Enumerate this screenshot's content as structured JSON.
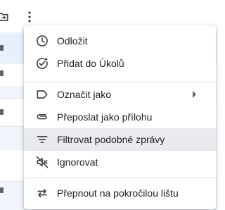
{
  "menu": {
    "items": [
      {
        "label": "Odložit",
        "icon": "clock-icon"
      },
      {
        "label": "Přidat do Úkolů",
        "icon": "add-task-icon"
      },
      {
        "label": "Označit jako",
        "icon": "label-icon",
        "has_submenu": true
      },
      {
        "label": "Přeposlat jako přílohu",
        "icon": "attachment-icon"
      },
      {
        "label": "Filtrovat podobné zprávy",
        "icon": "filter-icon",
        "highlighted": true
      },
      {
        "label": "Ignorovat",
        "icon": "mute-icon"
      },
      {
        "label": "Přepnout na pokročilou lištu",
        "icon": "swap-icon"
      }
    ]
  },
  "background_toolbar": {
    "icons": [
      "move-to-icon",
      "more-vert-icon"
    ]
  },
  "colors": {
    "icon": "#444746",
    "text": "#1f1f1f",
    "highlight": "#e8eaed",
    "selected_row": "#e8f0fe",
    "divider": "#e0e0e0"
  }
}
